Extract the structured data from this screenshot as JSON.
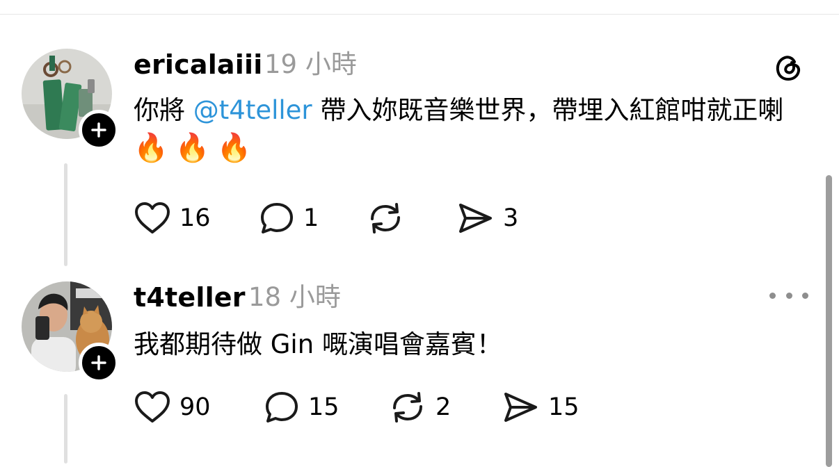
{
  "posts": [
    {
      "username": "ericalaiii",
      "time": "19 小時",
      "text_before": "你將 ",
      "mention": "@t4teller",
      "text_after": " 帶入妳既音樂世界，帶埋入紅館咁就正喇",
      "emoji": "🔥🔥🔥",
      "likes": "16",
      "replies": "1",
      "reposts": "",
      "shares": "3",
      "corner_icon": "threads-logo-icon"
    },
    {
      "username": "t4teller",
      "time": "18 小時",
      "text": "我都期待做 Gin 嘅演唱會嘉賓！",
      "likes": "90",
      "replies": "15",
      "reposts": "2",
      "shares": "15",
      "corner_icon": "more-options-icon"
    }
  ],
  "colors": {
    "mention": "#2d94d9",
    "secondary_text": "#9a9a9a",
    "follow_badge": "#000000"
  }
}
